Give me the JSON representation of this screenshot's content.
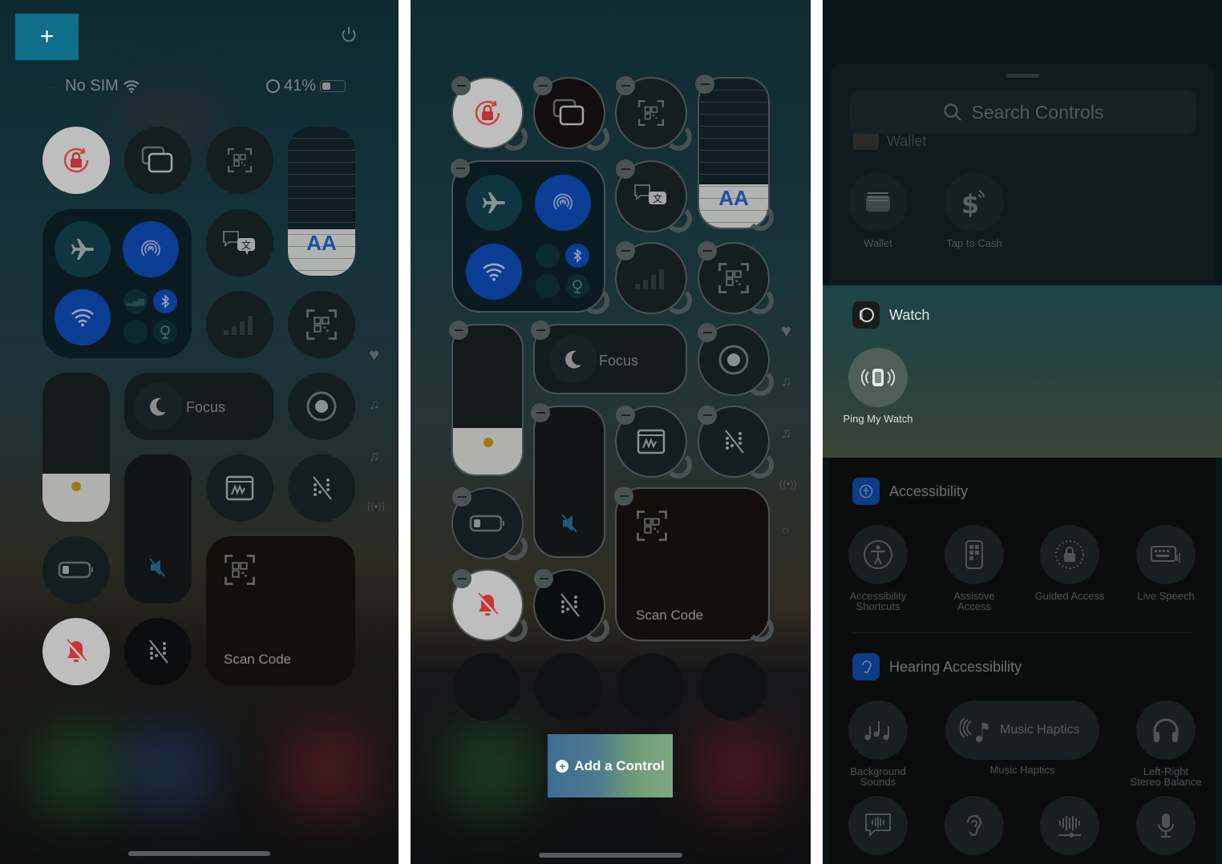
{
  "panel1": {
    "add_button_label": "+",
    "status": {
      "carrier": "No SIM",
      "battery_percent": "41%",
      "battery_level": 0.41
    },
    "focus_label": "Focus",
    "scan_code_label": "Scan Code",
    "text_size_label": "AA",
    "icons": [
      "power-icon",
      "orientation-lock-icon",
      "screen-mirroring-icon",
      "qr-code-icon",
      "text-size-slider",
      "airplane-mode-icon",
      "airdrop-icon",
      "wifi-icon",
      "cellular-icon",
      "bluetooth-icon",
      "vpn-icon",
      "satellite-icon",
      "translate-icon",
      "signal-bars-icon",
      "qr-code-icon",
      "brightness-slider",
      "focus-moon-icon",
      "screen-recording-icon",
      "volume-slider",
      "markup-icon",
      "hearing-off-icon",
      "low-power-icon",
      "scan-code-icon",
      "silent-mode-icon",
      "hearing-off-icon"
    ]
  },
  "panel2": {
    "focus_label": "Focus",
    "scan_code_label": "Scan Code",
    "text_size_label": "AA",
    "add_control_label": "Add a Control"
  },
  "panel3": {
    "search_placeholder": "Search Controls",
    "wallet_section": {
      "title": "Wallet",
      "controls": [
        {
          "label": "Wallet",
          "icon": "wallet-icon"
        },
        {
          "label": "Tap to Cash",
          "icon": "tap-to-cash-icon"
        }
      ]
    },
    "watch_section": {
      "title": "Watch",
      "controls": [
        {
          "label": "Ping My Watch",
          "icon": "ping-watch-icon"
        }
      ]
    },
    "accessibility_section": {
      "title": "Accessibility",
      "controls": [
        {
          "label_line1": "Accessibility",
          "label_line2": "Shortcuts",
          "icon": "accessibility-icon"
        },
        {
          "label_line1": "Assistive",
          "label_line2": "Access",
          "icon": "assistive-access-icon"
        },
        {
          "label_line1": "Guided Access",
          "label_line2": "",
          "icon": "guided-access-icon"
        },
        {
          "label_line1": "Live Speech",
          "label_line2": "",
          "icon": "live-speech-icon"
        }
      ]
    },
    "hearing_section": {
      "title": "Hearing Accessibility",
      "controls": [
        {
          "label_line1": "Background",
          "label_line2": "Sounds",
          "icon": "background-sounds-icon"
        },
        {
          "label_line1": "Music Haptics",
          "label_line2": "",
          "pill_label": "Music Haptics",
          "icon": "music-haptics-icon"
        },
        {
          "label_line1": "Left-Right",
          "label_line2": "Stereo Balance",
          "icon": "headphones-icon"
        }
      ]
    }
  }
}
